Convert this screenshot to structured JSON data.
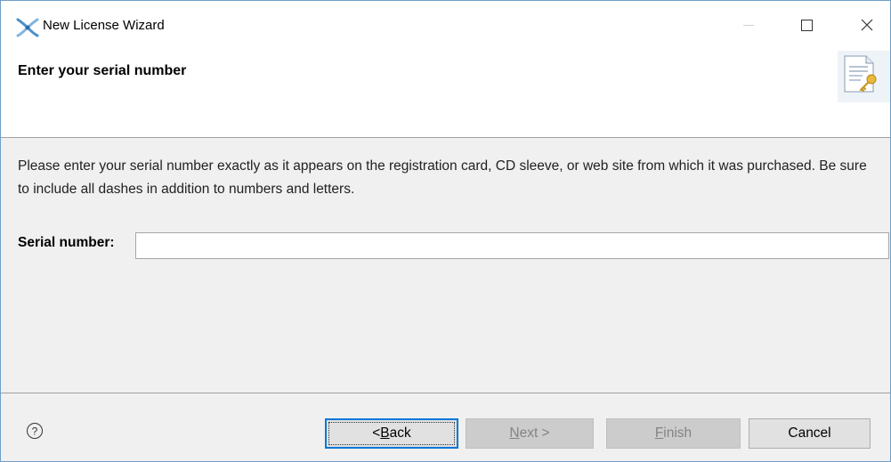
{
  "window": {
    "title": "New License Wizard"
  },
  "header": {
    "title": "Enter your serial number"
  },
  "main": {
    "description": "Please enter your serial number exactly as it appears on the registration card, CD sleeve, or web site from which it was purchased. Be sure to include all dashes in addition to numbers and letters.",
    "serial_label": "Serial number:",
    "serial_value": ""
  },
  "footer": {
    "back": {
      "prefix": "< ",
      "mnemonic": "B",
      "rest": "ack"
    },
    "next": {
      "mnemonic": "N",
      "rest": "ext >"
    },
    "finish": {
      "mnemonic": "F",
      "rest": "inish"
    },
    "cancel": "Cancel",
    "help_icon": "question-circle-icon"
  },
  "colors": {
    "focus_border": "#0078d7",
    "dialog_bg": "#f0f0f0",
    "disabled_text": "#838383"
  }
}
